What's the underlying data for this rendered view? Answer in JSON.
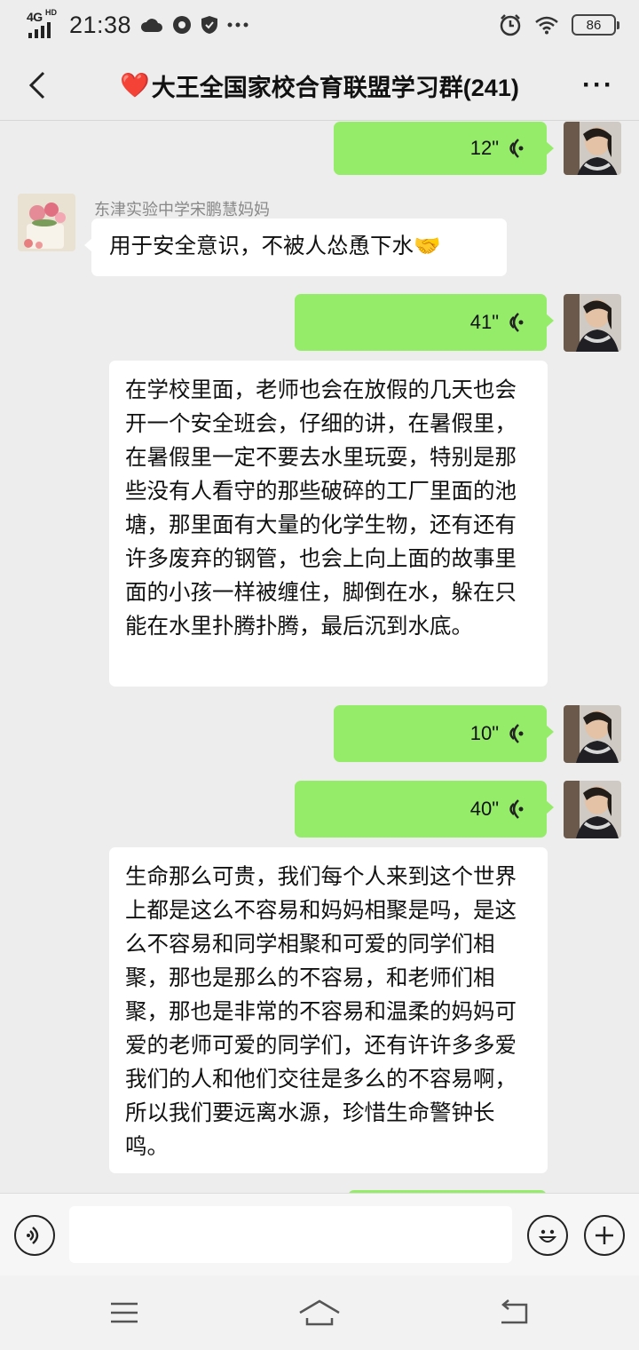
{
  "status_bar": {
    "network": "4G",
    "network_hd": "HD",
    "time": "21:38",
    "battery": "86",
    "icons": [
      "cloud-icon",
      "vpn-icon",
      "shield-icon",
      "more-dots-icon",
      "alarm-icon",
      "wifi-icon"
    ]
  },
  "header": {
    "heart": "❤️",
    "title": "大王全国家校合育联盟学习群(241)",
    "more": "···"
  },
  "messages": [
    {
      "type": "voice",
      "side": "right",
      "duration": "12\""
    },
    {
      "type": "text",
      "side": "left",
      "sender": "东津实验中学宋鹏慧妈妈",
      "text": "用于安全意识，不被人怂恿下水",
      "emoji": "🤝"
    },
    {
      "type": "voice",
      "side": "right",
      "duration": "41\""
    },
    {
      "type": "text",
      "side": "left",
      "text": "在学校里面，老师也会在放假的几天也会开一个安全班会，仔细的讲，在暑假里，在暑假里一定不要去水里玩耍，特别是那些没有人看守的那些破碎的工厂里面的池塘，那里面有大量的化学生物，还有还有许多废弃的钢管，也会上向上面的故事里面的小孩一样被缠住，脚倒在水，躲在只能在水里扑腾扑腾，最后沉到水底。"
    },
    {
      "type": "voice",
      "side": "right",
      "duration": "10\""
    },
    {
      "type": "voice",
      "side": "right",
      "duration": "40\""
    },
    {
      "type": "text",
      "side": "left",
      "text": "生命那么可贵，我们每个人来到这个世界上都是这么不容易和妈妈相聚是吗，是这么不容易和同学相聚和可爱的同学们相聚，那也是那么的不容易，和老师们相聚，那也是非常的不容易和温柔的妈妈可爱的老师可爱的同学们，还有许许多多爱我们的人和他们交往是多么的不容易啊，所以我们要远离水源，珍惜生命警钟长鸣。"
    }
  ],
  "input_bar": {
    "voice_button": "voice-input-icon",
    "emoji_button": "emoji-icon",
    "plus_button": "plus-icon",
    "value": ""
  },
  "nav_bar": [
    "menu-icon",
    "home-icon",
    "back-icon"
  ],
  "colors": {
    "self_bubble": "#95ec69",
    "other_bubble": "#ffffff",
    "background": "#ededed"
  }
}
